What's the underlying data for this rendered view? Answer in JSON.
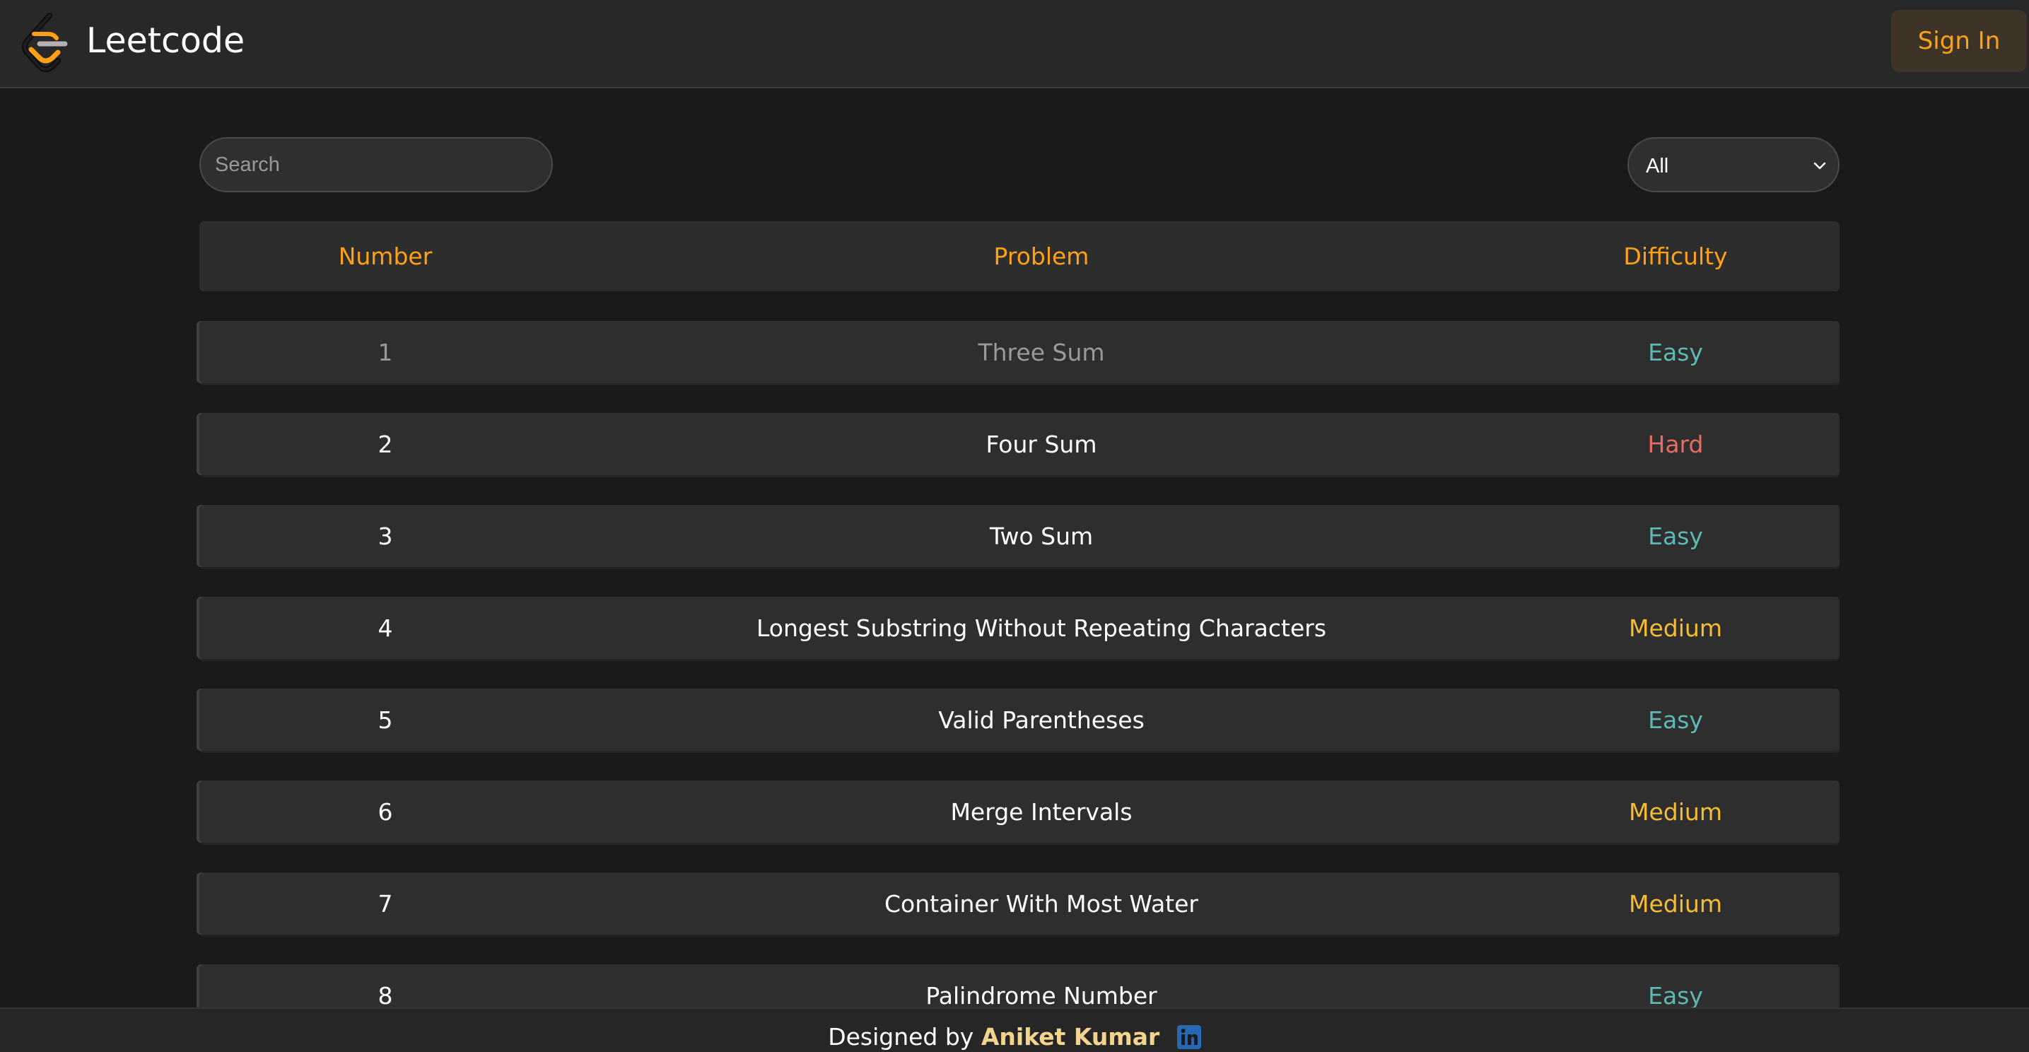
{
  "header": {
    "brand": "Leetcode",
    "sign_in": "Sign In"
  },
  "toolbar": {
    "search_placeholder": "Search",
    "filter_value": "All"
  },
  "table": {
    "columns": [
      "Number",
      "Problem",
      "Difficulty"
    ],
    "rows": [
      {
        "number": "1",
        "problem": "Three Sum",
        "difficulty": "Easy"
      },
      {
        "number": "2",
        "problem": "Four Sum",
        "difficulty": "Hard"
      },
      {
        "number": "3",
        "problem": "Two Sum",
        "difficulty": "Easy"
      },
      {
        "number": "4",
        "problem": "Longest Substring Without Repeating Characters",
        "difficulty": "Medium"
      },
      {
        "number": "5",
        "problem": "Valid Parentheses",
        "difficulty": "Easy"
      },
      {
        "number": "6",
        "problem": "Merge Intervals",
        "difficulty": "Medium"
      },
      {
        "number": "7",
        "problem": "Container With Most Water",
        "difficulty": "Medium"
      },
      {
        "number": "8",
        "problem": "Palindrome Number",
        "difficulty": "Easy"
      }
    ]
  },
  "difficulty_colors": {
    "Easy": "#5eb8b4",
    "Medium": "#f5bd33",
    "Hard": "#e86b63"
  },
  "accent_color": "#ffa116",
  "footer": {
    "designed_by": "Designed by",
    "author": "Aniket Kumar",
    "social_icon": "linkedin-icon"
  }
}
